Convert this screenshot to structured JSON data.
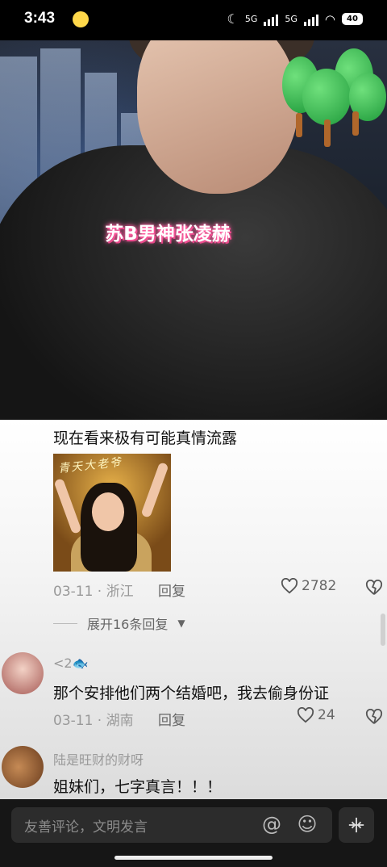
{
  "status_bar": {
    "time": "3:43",
    "network_1": "5G",
    "network_2": "5G",
    "battery": "40"
  },
  "video": {
    "caption": "苏B男神张凌赫"
  },
  "comments": {
    "first": {
      "text": "现在看来极有可能真情流露",
      "image_text": "青天大老爷",
      "date": "03-11 · 浙江",
      "reply_label": "回复",
      "likes": "2782"
    },
    "expand_label": "展开16条回复",
    "second": {
      "username": "<2",
      "text": "那个安排他们两个结婚吧，我去偷身份证",
      "date": "03-11 · 湖南",
      "reply_label": "回复",
      "likes": "24"
    },
    "third": {
      "username": "陆是旺财的财呀",
      "text": "姐妹们，七字真言！！！"
    }
  },
  "bottom_bar": {
    "placeholder": "友善评论，文明发言"
  },
  "colors": {
    "caption_glow": "#ff5fa2",
    "comments_bg": "#ffffff",
    "bottom_bar_bg": "#161616"
  },
  "icons": [
    "heart-icon",
    "broken-heart-icon",
    "chevron-down-icon",
    "at-icon",
    "emoji-icon",
    "collapse-icon",
    "fish-icon"
  ]
}
